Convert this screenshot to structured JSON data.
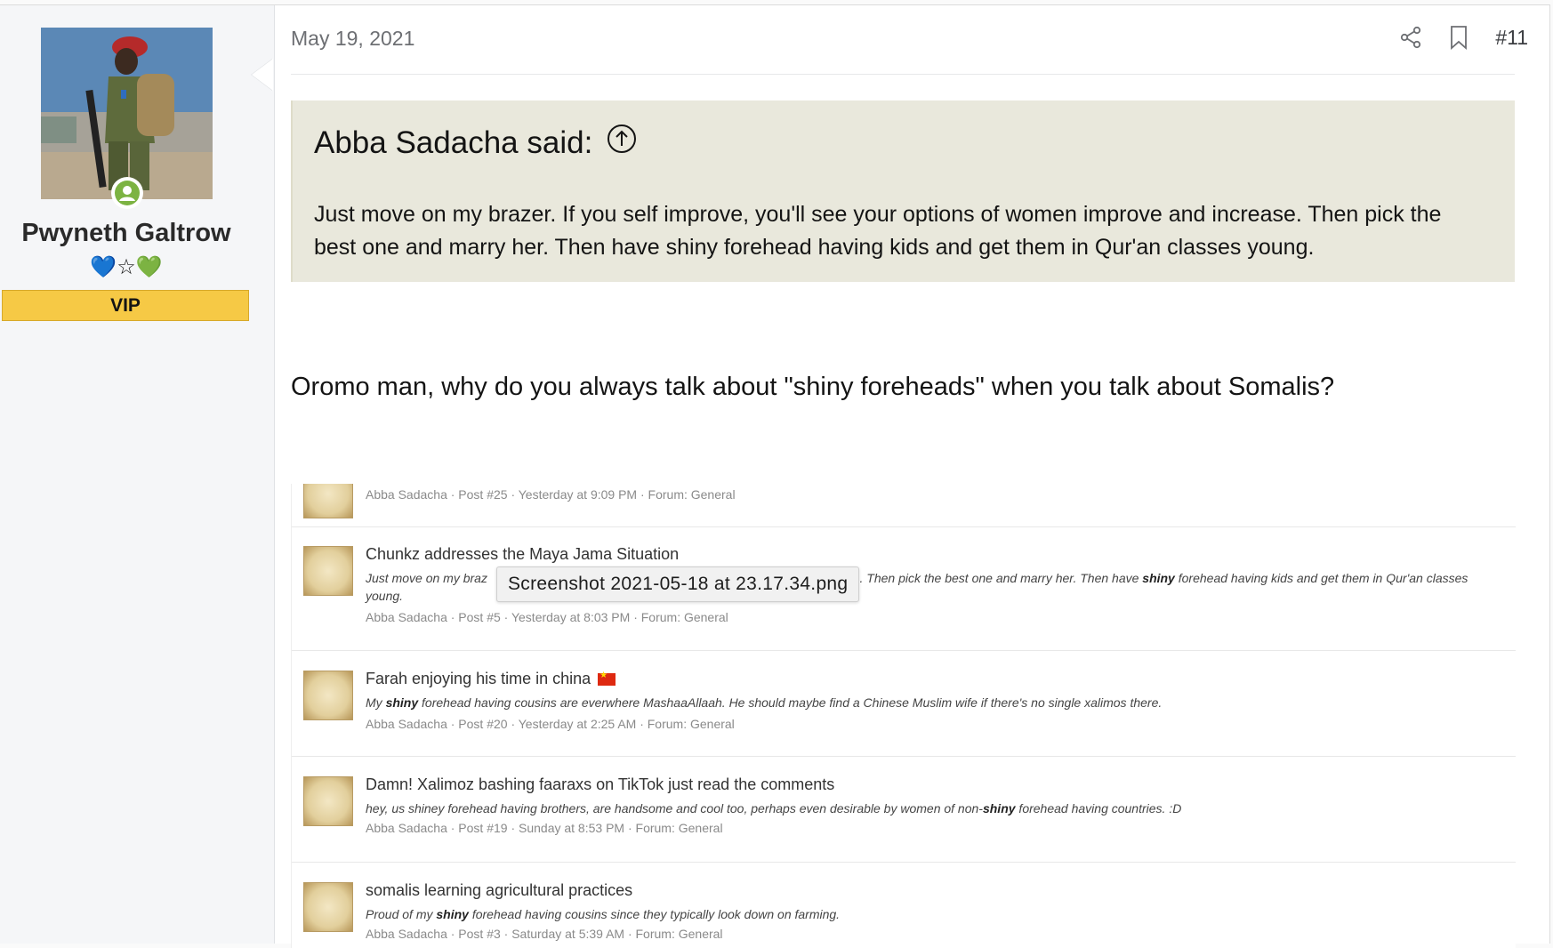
{
  "user": {
    "name": "Pwyneth Galtrow",
    "icons": [
      "💙",
      "☆",
      "💚"
    ],
    "badge": "VIP",
    "avatar_icon": "soldier-photo-avatar",
    "status_icon": "online-user-icon"
  },
  "post": {
    "date": "May 19, 2021",
    "number": "#11",
    "actions": [
      "share-icon",
      "bookmark-icon"
    ],
    "quote": {
      "author_said": "Abba Sadacha said:",
      "jump_icon": "arrow-up-circle-icon",
      "text": "Just move on my brazer. If you self improve, you'll see your options of women improve and increase. Then pick the best one and marry her. Then have shiny forehead having kids and get them in Qur'an classes young."
    },
    "body": "Oromo man, why do you always talk about \"shiny foreheads\" when you talk about Somalis?"
  },
  "attachment": {
    "tooltip": "Screenshot 2021-05-18 at 23.17.34.png",
    "results": [
      {
        "title": "",
        "snippet_parts": [],
        "meta": "Abba Sadacha · Post #25 · Yesterday at 9:09 PM · Forum: General"
      },
      {
        "title": "Chunkz addresses the Maya Jama Situation",
        "snippet_parts": [
          {
            "t": "Just move on my braz",
            "b": false
          },
          {
            "t": "                                                                                       ",
            "b": false
          },
          {
            "t": "and increase. Then pick the best one and marry her. Then have ",
            "b": false
          },
          {
            "t": "shiny",
            "b": true
          },
          {
            "t": " forehead having kids and get them in Qur'an classes young.",
            "b": false
          }
        ],
        "meta": "Abba Sadacha · Post #5 · Yesterday at 8:03 PM · Forum: General"
      },
      {
        "title": "Farah enjoying his time in china",
        "snippet_parts": [
          {
            "t": "My ",
            "b": false
          },
          {
            "t": "shiny",
            "b": true
          },
          {
            "t": " forehead having cousins are everwhere MashaaAllaah. He should maybe find a Chinese Muslim wife if there's no single xalimos there.",
            "b": false
          }
        ],
        "meta": "Abba Sadacha · Post #20 · Yesterday at 2:25 AM · Forum: General"
      },
      {
        "title": "Damn! Xalimoz bashing faaraxs on TikTok just read the comments",
        "snippet_parts": [
          {
            "t": "hey, us shiney forehead having brothers, are handsome and cool too, perhaps even desirable by women of non-",
            "b": false
          },
          {
            "t": "shiny",
            "b": true
          },
          {
            "t": " forehead having countries. :D",
            "b": false
          }
        ],
        "meta": "Abba Sadacha · Post #19 · Sunday at 8:53 PM · Forum: General"
      },
      {
        "title": "somalis learning agricultural practices",
        "snippet_parts": [
          {
            "t": "Proud of my ",
            "b": false
          },
          {
            "t": "shiny",
            "b": true
          },
          {
            "t": " forehead having cousins since they typically look down on farming.",
            "b": false
          }
        ],
        "meta": "Abba Sadacha · Post #3 · Saturday at 5:39 AM · Forum: General"
      }
    ]
  }
}
